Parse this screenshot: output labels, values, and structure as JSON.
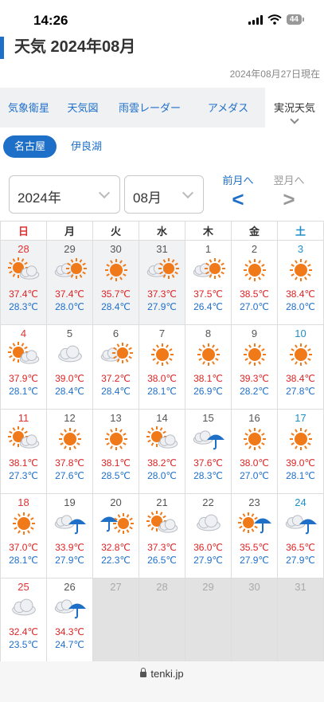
{
  "status": {
    "time": "14:26",
    "battery": "44"
  },
  "title": "天気 2024年08月",
  "as_of": "2024年08月27日現在",
  "tabs": [
    "気象衛星",
    "天気図",
    "雨雲レーダー",
    "アメダス",
    "実況天気"
  ],
  "chips": [
    "名古屋",
    "伊良湖"
  ],
  "selectors": {
    "year": "2024年",
    "month": "08月"
  },
  "nav": {
    "prev_label": "前月へ",
    "next_label": "翌月へ",
    "prev_arrow": "<",
    "next_arrow": ">"
  },
  "weekdays": [
    "日",
    "月",
    "火",
    "水",
    "木",
    "金",
    "土"
  ],
  "days": [
    {
      "day": "28",
      "icon": "sun-cloud",
      "hi": "37.4℃",
      "lo": "28.3℃"
    },
    {
      "day": "29",
      "icon": "cloud-sun",
      "hi": "37.4℃",
      "lo": "28.0℃"
    },
    {
      "day": "30",
      "icon": "sun",
      "hi": "35.7℃",
      "lo": "28.4℃"
    },
    {
      "day": "31",
      "icon": "cloud-sun",
      "hi": "37.3℃",
      "lo": "27.9℃"
    },
    {
      "day": "1",
      "icon": "cloud-sun",
      "hi": "37.5℃",
      "lo": "26.4℃"
    },
    {
      "day": "2",
      "icon": "sun",
      "hi": "38.5℃",
      "lo": "27.0℃"
    },
    {
      "day": "3",
      "icon": "sun",
      "hi": "38.4℃",
      "lo": "28.0℃"
    },
    {
      "day": "4",
      "icon": "sun-cloud",
      "hi": "37.9℃",
      "lo": "28.1℃"
    },
    {
      "day": "5",
      "icon": "cloud",
      "hi": "39.0℃",
      "lo": "28.4℃"
    },
    {
      "day": "6",
      "icon": "cloud-sun",
      "hi": "37.2℃",
      "lo": "28.4℃"
    },
    {
      "day": "7",
      "icon": "sun",
      "hi": "38.0℃",
      "lo": "28.1℃"
    },
    {
      "day": "8",
      "icon": "sun",
      "hi": "38.1℃",
      "lo": "26.9℃"
    },
    {
      "day": "9",
      "icon": "sun",
      "hi": "39.3℃",
      "lo": "28.2℃"
    },
    {
      "day": "10",
      "icon": "sun",
      "hi": "38.4℃",
      "lo": "27.8℃"
    },
    {
      "day": "11",
      "icon": "sun-cloud",
      "hi": "38.1℃",
      "lo": "27.3℃"
    },
    {
      "day": "12",
      "icon": "sun",
      "hi": "37.8℃",
      "lo": "27.6℃"
    },
    {
      "day": "13",
      "icon": "sun",
      "hi": "38.1℃",
      "lo": "28.5℃"
    },
    {
      "day": "14",
      "icon": "sun-cloud",
      "hi": "38.2℃",
      "lo": "28.0℃"
    },
    {
      "day": "15",
      "icon": "cloud-umbrella",
      "hi": "37.6℃",
      "lo": "28.3℃"
    },
    {
      "day": "16",
      "icon": "sun",
      "hi": "38.0℃",
      "lo": "27.0℃"
    },
    {
      "day": "17",
      "icon": "sun",
      "hi": "39.0℃",
      "lo": "28.1℃"
    },
    {
      "day": "18",
      "icon": "sun",
      "hi": "37.0℃",
      "lo": "28.1℃"
    },
    {
      "day": "19",
      "icon": "cloud-umbrella",
      "hi": "33.9℃",
      "lo": "27.9℃"
    },
    {
      "day": "20",
      "icon": "umbrella-sun",
      "hi": "32.8℃",
      "lo": "22.3℃"
    },
    {
      "day": "21",
      "icon": "sun-cloud",
      "hi": "37.3℃",
      "lo": "26.5℃"
    },
    {
      "day": "22",
      "icon": "cloud",
      "hi": "36.0℃",
      "lo": "27.9℃"
    },
    {
      "day": "23",
      "icon": "sun-umbrella",
      "hi": "35.5℃",
      "lo": "27.9℃"
    },
    {
      "day": "24",
      "icon": "cloud-umbrella",
      "hi": "36.5℃",
      "lo": "27.9℃"
    },
    {
      "day": "25",
      "icon": "cloud",
      "hi": "32.4℃",
      "lo": "23.5℃"
    },
    {
      "day": "26",
      "icon": "cloud-umbrella",
      "hi": "34.3℃",
      "lo": "24.7℃"
    },
    {
      "day": "27",
      "icon": "",
      "hi": "",
      "lo": ""
    },
    {
      "day": "28",
      "icon": "",
      "hi": "",
      "lo": ""
    },
    {
      "day": "29",
      "icon": "",
      "hi": "",
      "lo": ""
    },
    {
      "day": "30",
      "icon": "",
      "hi": "",
      "lo": ""
    },
    {
      "day": "31",
      "icon": "",
      "hi": "",
      "lo": ""
    }
  ],
  "browser": {
    "url": "tenki.jp"
  },
  "colors": {
    "accent": "#1e6fc8",
    "high_temp": "#dd2222",
    "low_temp": "#1e6fc8",
    "sun": "#f07a1a",
    "umbrella": "#1e6fc8"
  }
}
